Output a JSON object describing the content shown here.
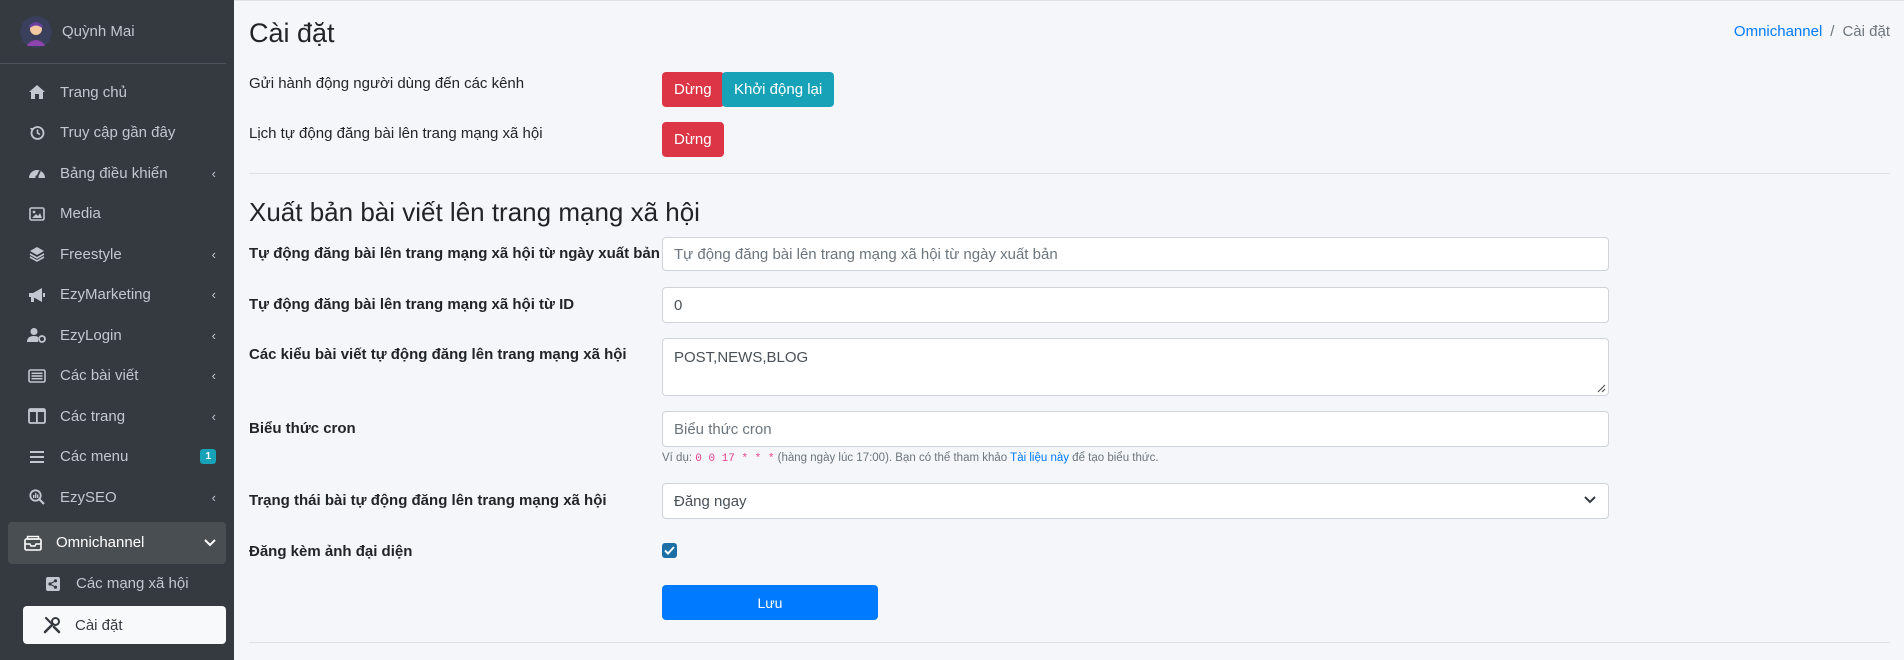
{
  "sidebar": {
    "user": {
      "name": "Quỳnh Mai"
    },
    "items": [
      {
        "label": "Trang chủ",
        "icon": "home-icon"
      },
      {
        "label": "Truy cập gần đây",
        "icon": "history-icon"
      },
      {
        "label": "Bảng điều khiển",
        "icon": "dashboard-icon",
        "caret": "‹"
      },
      {
        "label": "Media",
        "icon": "image-icon"
      },
      {
        "label": "Freestyle",
        "icon": "layers-icon",
        "caret": "‹"
      },
      {
        "label": "EzyMarketing",
        "icon": "megaphone-icon",
        "caret": "‹"
      },
      {
        "label": "EzyLogin",
        "icon": "user-cog-icon",
        "caret": "‹"
      },
      {
        "label": "Các bài viết",
        "icon": "list-icon",
        "caret": "‹"
      },
      {
        "label": "Các trang",
        "icon": "columns-icon",
        "caret": "‹"
      },
      {
        "label": "Các menu",
        "icon": "bars-icon",
        "badge": "1"
      },
      {
        "label": "EzySEO",
        "icon": "search-chart-icon",
        "caret": "‹"
      },
      {
        "label": "Omnichannel",
        "icon": "inbox-icon",
        "caret": "⌄"
      },
      {
        "label": "Các mạng xã hội",
        "icon": "share-icon"
      },
      {
        "label": "Cài đặt",
        "icon": "tools-icon"
      }
    ]
  },
  "header": {
    "title": "Cài đặt",
    "breadcrumb": {
      "parent": "Omnichannel",
      "separator": "/",
      "current": "Cài đặt"
    }
  },
  "controls": {
    "row1_label": "Gửi hành động người dùng đến các kênh",
    "row1_stop": "Dừng",
    "row1_restart": "Khởi động lại",
    "row2_label": "Lịch tự động đăng bài lên trang mạng xã hội",
    "row2_stop": "Dừng"
  },
  "form": {
    "section_title": "Xuất bản bài viết lên trang mạng xã hội",
    "from_date_label": "Tự động đăng bài lên trang mạng xã hội từ ngày xuất bản",
    "from_date_placeholder": "Tự động đăng bài lên trang mạng xã hội từ ngày xuất bản",
    "from_id_label": "Tự động đăng bài lên trang mạng xã hội từ ID",
    "from_id_value": "0",
    "types_label": "Các kiểu bài viết tự động đăng lên trang mạng xã hội",
    "types_value": "POST,NEWS,BLOG",
    "cron_label": "Biểu thức cron",
    "cron_placeholder": "Biểu thức cron",
    "cron_help_prefix": "Ví dụ: ",
    "cron_help_code": "0 0 17 * * *",
    "cron_help_middle": " (hàng ngày lúc 17:00). Bạn có thể tham khảo ",
    "cron_help_link": "Tài liệu này",
    "cron_help_suffix": " để tạo biểu thức.",
    "status_label": "Trạng thái bài tự động đăng lên trang mạng xã hội",
    "status_value": "Đăng ngay",
    "featured_label": "Đăng kèm ảnh đại diện",
    "featured_checked": true,
    "save_label": "Lưu"
  },
  "colors": {
    "sidebar_bg": "#343a40",
    "danger": "#dc3545",
    "info": "#17a2b8",
    "primary": "#007bff"
  }
}
